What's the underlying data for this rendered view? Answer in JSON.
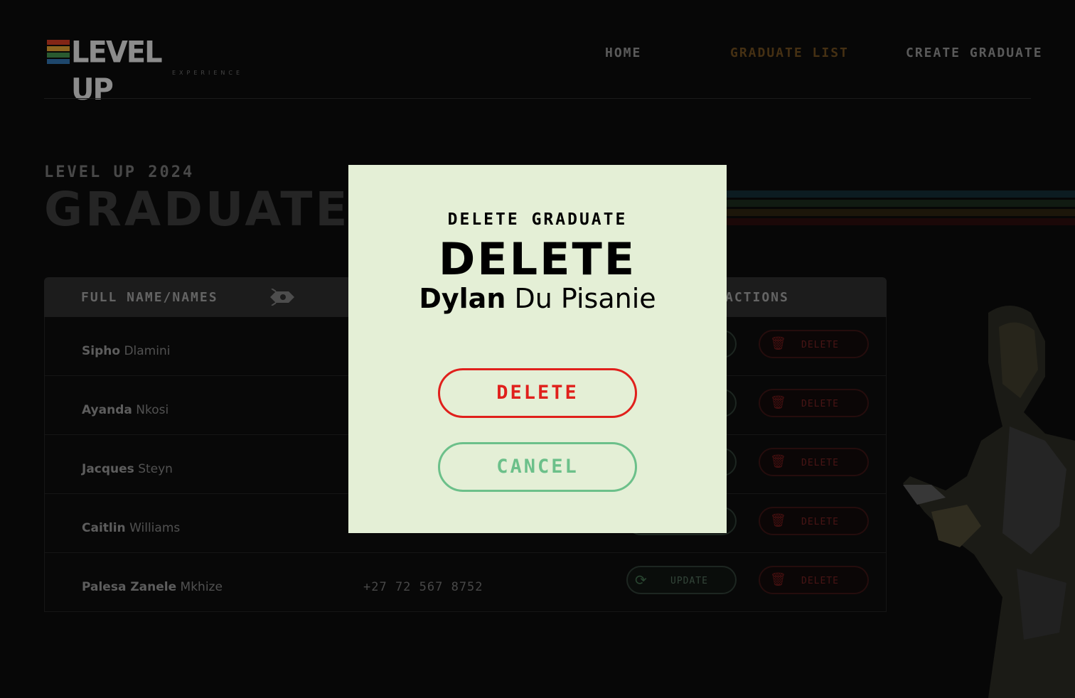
{
  "brand": {
    "logo_word": "LEVEL UP",
    "logo_sub": "EXPERIENCE",
    "stripe_colors": [
      "#d64a2a",
      "#e0a43a",
      "#3f8a4a",
      "#2e6ea6"
    ]
  },
  "nav": {
    "home": "HOME",
    "graduate_list": "GRADUATE LIST",
    "create_graduate": "CREATE GRADUATE"
  },
  "page": {
    "kicker": "LEVEL UP 2024",
    "title": "GRADUATE"
  },
  "table": {
    "headers": {
      "name": "FULL NAME/NAMES",
      "actions": "ACTIONS"
    },
    "rows": [
      {
        "first": "Sipho",
        "last": "Dlamini",
        "phone": ""
      },
      {
        "first": "Ayanda",
        "last": "Nkosi",
        "phone": ""
      },
      {
        "first": "Jacques",
        "last": "Steyn",
        "phone": ""
      },
      {
        "first": "Caitlin",
        "last": "Williams",
        "phone": ""
      },
      {
        "first": "Palesa Zanele",
        "last": "Mkhize",
        "phone": "+27 72 567 8752"
      }
    ],
    "update_label": "UPDATE",
    "delete_label": "DELETE"
  },
  "modal": {
    "kicker": "DELETE GRADUATE",
    "title": "DELETE",
    "first_name": "Dylan",
    "last_name": "Du Pisanie",
    "confirm_label": "DELETE",
    "cancel_label": "CANCEL"
  },
  "colors": {
    "accent_red": "#e0201c",
    "accent_green": "#6cc08a",
    "modal_bg": "#e4efd6"
  },
  "icons": {
    "sort": "rocket-sort-icon",
    "update": "refresh-icon",
    "delete": "trash-icon"
  }
}
